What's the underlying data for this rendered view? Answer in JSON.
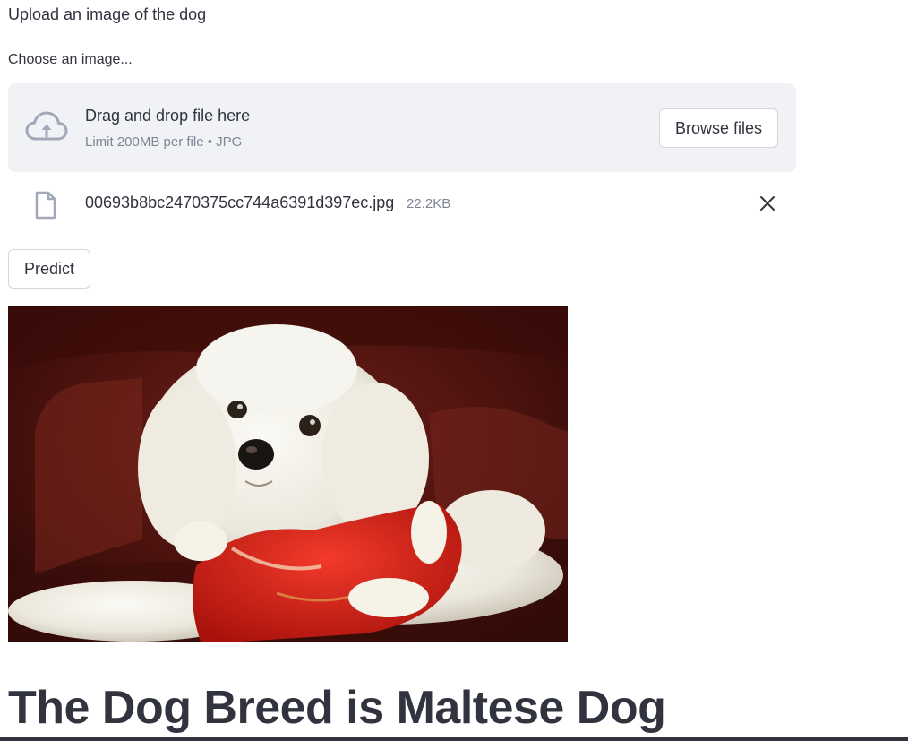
{
  "intro_text": "Upload an image of the dog",
  "uploader": {
    "label": "Choose an image...",
    "drop_title": "Drag and drop file here",
    "drop_limit": "Limit 200MB per file • JPG",
    "browse_label": "Browse files",
    "icon": "cloud-upload-icon"
  },
  "uploaded_file": {
    "name": "00693b8bc2470375cc744a6391d397ec.jpg",
    "size": "22.2KB",
    "icon": "file-icon",
    "remove_icon": "close-icon"
  },
  "predict_label": "Predict",
  "result_heading": "The Dog Breed is Maltese Dog",
  "colors": {
    "text": "#31333f",
    "muted": "#808495",
    "dropzone_bg": "#f0f2f6",
    "border": "#d4d6dc",
    "icon": "#a3a8b8"
  }
}
